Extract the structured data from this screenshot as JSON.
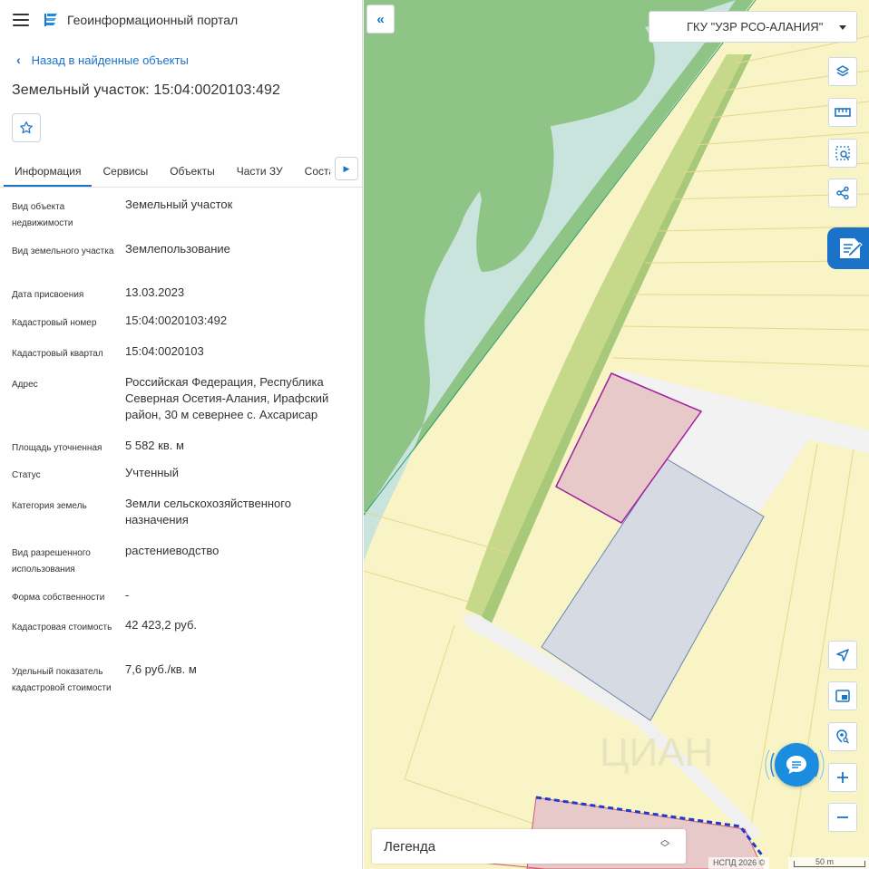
{
  "header": {
    "app_title": "Геоинформационный портал",
    "menu_icon": "hamburger-menu-icon",
    "logo_icon": "portal-logo-icon"
  },
  "nav": {
    "back_label": "Назад в найденные объекты"
  },
  "object": {
    "title": "Земельный участок: 15:04:0020103:492"
  },
  "tabs": [
    {
      "label": "Информация",
      "active": true
    },
    {
      "label": "Сервисы",
      "active": false
    },
    {
      "label": "Объекты",
      "active": false
    },
    {
      "label": "Части ЗУ",
      "active": false
    },
    {
      "label": "Состав",
      "active": false
    }
  ],
  "properties": [
    {
      "label": "Вид объекта недвижимости",
      "value": "Земельный участок"
    },
    {
      "label": "Вид земельного участка",
      "value": "Землепользование"
    },
    {
      "label": "Дата присвоения",
      "value": "13.03.2023"
    },
    {
      "label": "Кадастровый номер",
      "value": "15:04:0020103:492"
    },
    {
      "label": "Кадастровый квартал",
      "value": "15:04:0020103"
    },
    {
      "label": "Адрес",
      "value": "Российская Федерация, Республика Северная Осетия-Алания, Ирафский район, 30 м севернее с. Ахсарисар"
    },
    {
      "label": "Площадь уточненная",
      "value": "5 582 кв. м"
    },
    {
      "label": "Статус",
      "value": "Учтенный"
    },
    {
      "label": "Категория земель",
      "value": "Земли сельскохозяйственного назначения"
    },
    {
      "label": "Вид разрешенного использования",
      "value": "растениеводство"
    },
    {
      "label": "Форма собственности",
      "value": "-"
    },
    {
      "label": "Кадастровая стоимость",
      "value": "42 423,2 руб."
    },
    {
      "label": "Удельный показатель кадастровой стоимости",
      "value": "7,6 руб./кв. м"
    }
  ],
  "map": {
    "org_select": "ГКУ \"УЗР РСО-АЛАНИЯ\"",
    "legend_label": "Легенда",
    "copyright": "НСПД 2026 ©",
    "scale_label": "50 m",
    "tools_top": [
      "layers-icon",
      "ruler-icon",
      "select-area-icon",
      "share-icon"
    ],
    "tools_bottom": [
      "locate-icon",
      "minimap-icon",
      "geo-search-icon",
      "zoom-in-icon",
      "zoom-out-icon"
    ],
    "colors": {
      "accent": "#1a73c8",
      "land": "#f8f4c6",
      "forest": "#8ec486",
      "water": "#c9e3dd",
      "parcel_selected_fill": "#e8c9c9",
      "parcel_selected_stroke": "#a020a0",
      "parcel_neighbor_fill": "#d6dbe3"
    }
  }
}
